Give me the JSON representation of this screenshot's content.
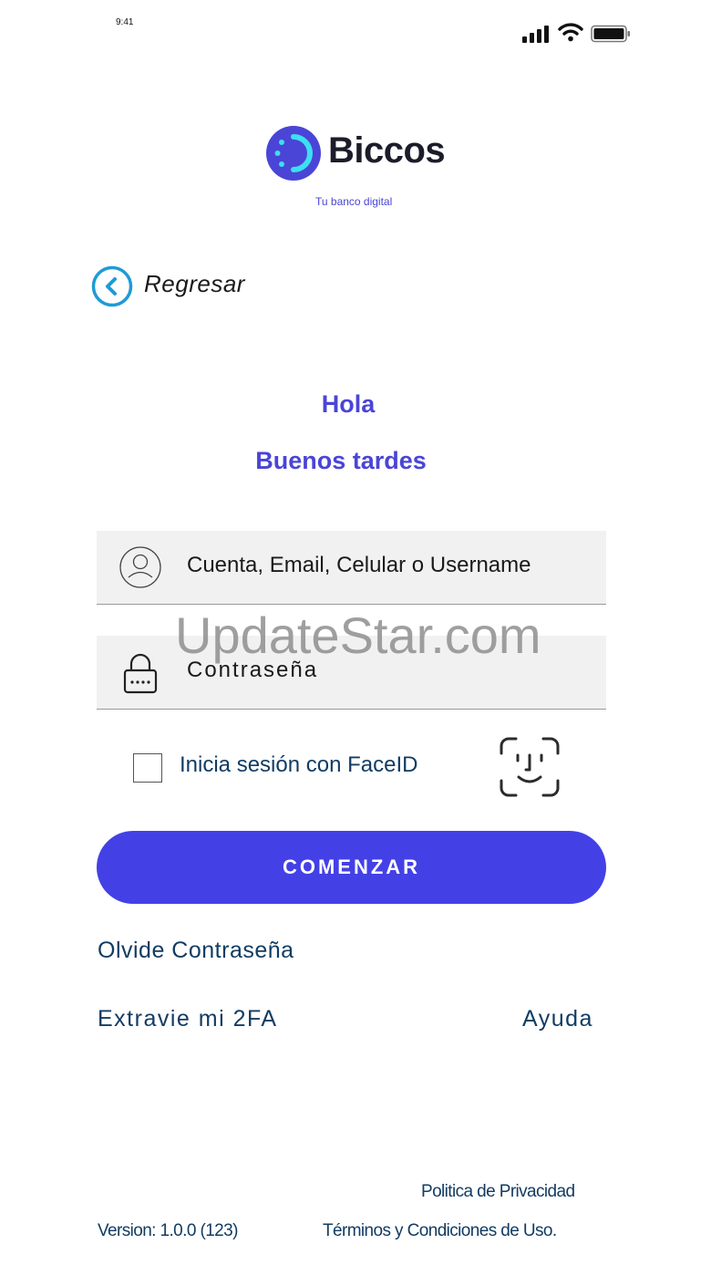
{
  "status_bar": {
    "time": "9:41"
  },
  "brand": {
    "name": "Biccos",
    "tagline": "Tu banco digital"
  },
  "nav": {
    "back_label": "Regresar"
  },
  "greeting": {
    "hello": "Hola",
    "message": "Buenos tardes"
  },
  "form": {
    "username_placeholder": "Cuenta, Email, Celular o Username",
    "password_placeholder": "Contraseña",
    "faceid_label": "Inicia sesión con FaceID",
    "faceid_checked": false,
    "submit_label": "COMENZAR"
  },
  "links": {
    "forgot_password": "Olvide Contraseña",
    "lost_2fa": "Extravie mi 2FA",
    "help": "Ayuda"
  },
  "footer": {
    "privacy": "Politica de Privacidad",
    "version": "Version: 1.0.0 (123)",
    "terms": "Términos y Condiciones de Uso."
  },
  "watermark": "UpdateStar.com",
  "colors": {
    "accent": "#4341e6",
    "link_text": "#123c63",
    "back_ring": "#1e9bd7",
    "logo_circle": "#4a45d6",
    "logo_ring": "#3ddff0"
  }
}
